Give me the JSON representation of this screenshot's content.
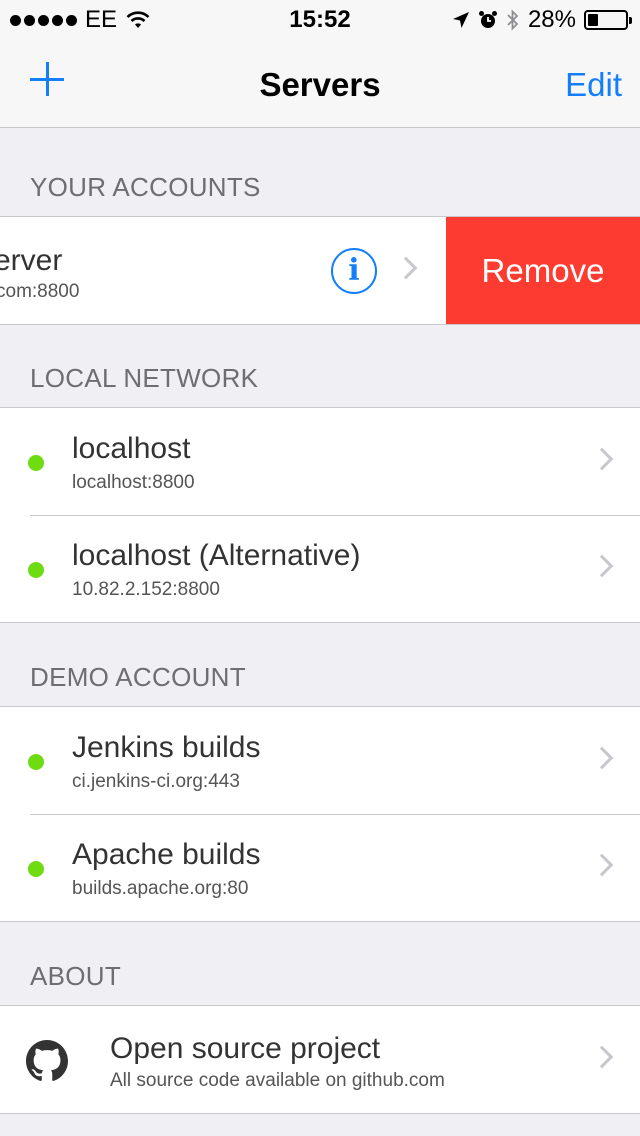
{
  "status_bar": {
    "carrier": "EE",
    "time": "15:52",
    "battery": "28%",
    "battery_level": 0.28
  },
  "nav": {
    "title": "Servers",
    "edit_label": "Edit",
    "add_icon": "plus-icon"
  },
  "sections": {
    "accounts": {
      "header": "YOUR ACCOUNTS",
      "item": {
        "title": "erver",
        "subtitle": "com:8800",
        "remove_label": "Remove"
      }
    },
    "local": {
      "header": "LOCAL NETWORK",
      "items": [
        {
          "title": "localhost",
          "subtitle": "localhost:8800"
        },
        {
          "title": "localhost (Alternative)",
          "subtitle": "10.82.2.152:8800"
        }
      ]
    },
    "demo": {
      "header": "DEMO ACCOUNT",
      "items": [
        {
          "title": "Jenkins builds",
          "subtitle": "ci.jenkins-ci.org:443"
        },
        {
          "title": "Apache builds",
          "subtitle": "builds.apache.org:80"
        }
      ]
    },
    "about": {
      "header": "ABOUT",
      "item": {
        "title": "Open source project",
        "subtitle": "All source code available on github.com",
        "icon": "github-icon"
      }
    }
  },
  "colors": {
    "accent": "#147efb",
    "status_online": "#6fdc12",
    "remove": "#fe3b30"
  }
}
